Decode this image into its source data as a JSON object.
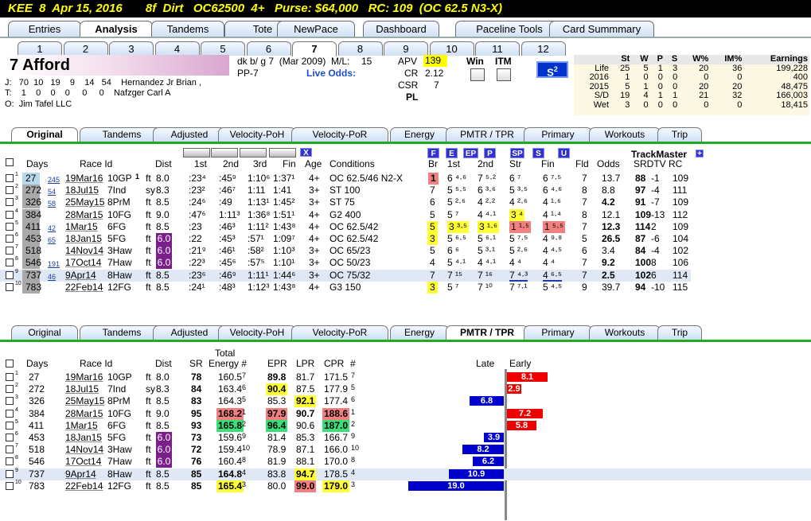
{
  "title": "KEE  8  Apr 15, 2016       8f  Dirt   OC62500  4+   Purse: $64,000   RC: 109  (OC 62.5 N3-X)",
  "menu_tabs": [
    "Entries",
    "Analysis",
    "Tandems",
    "Tote",
    "NewPace",
    "Dashboard",
    "Paceline Tools",
    "Card Summmary"
  ],
  "race_tabs": [
    "1",
    "2",
    "3",
    "4",
    "5",
    "6",
    "7",
    "8",
    "9",
    "10",
    "11",
    "12"
  ],
  "horse": {
    "name": "7   Afford",
    "desc": "dk b/ g 7  (Mar 2009)  M/L:",
    "ml": "15",
    "pp": "PP-7",
    "live_odds": "Live Odds:",
    "apv_label": "APV",
    "apv": "139",
    "cr_label": "CR",
    "cr": "2.12",
    "csr_label": "CSR",
    "csr": "7",
    "pl_label": "PL",
    "win_label": "Win",
    "itm_label": "ITM",
    "s_button": "S",
    "s_sup": "2",
    "jockey": "J:   70  10   19    9    14   54    Hernandez Jr Brian ,",
    "trainer": "T:    1    0    0    0     0     0    Nafzger Carl A",
    "owner": "O:  Jim Tafel LLC"
  },
  "stats": {
    "headers": [
      "",
      "St",
      "W",
      "P",
      "S",
      "W%",
      "IM%",
      "Earnings"
    ],
    "rows": [
      [
        "Life",
        "25",
        "5",
        "1",
        "3",
        "20",
        "36",
        "199,228"
      ],
      [
        "2016",
        "1",
        "0",
        "0",
        "0",
        "0",
        "0",
        "400"
      ],
      [
        "2015",
        "5",
        "1",
        "0",
        "0",
        "20",
        "20",
        "48,475"
      ],
      [
        "S/D",
        "19",
        "4",
        "1",
        "1",
        "21",
        "32",
        "166,003"
      ],
      [
        "Wet",
        "3",
        "0",
        "0",
        "0",
        "0",
        "0",
        "18,415"
      ]
    ]
  },
  "sub_tabs": [
    "Original",
    "Tandems",
    "Adjusted",
    "Velocity-PoH",
    "Velocity-PoR",
    "Energy",
    "PMTR / TPR",
    "Primary",
    "Workouts",
    "Trip"
  ],
  "grid1": {
    "headers": {
      "days": "Days",
      "race": "Race Id",
      "dist": "Dist",
      "c1": "1st",
      "c2": "2nd",
      "c3": "3rd",
      "fin": "Fin",
      "age": "Age",
      "cond": "Conditions",
      "br": "Br",
      "s1": "1st",
      "s2": "2nd",
      "str": "Str",
      "fin2": "Fin",
      "fld": "Fld",
      "odds": "Odds",
      "tm": "TrackMaster",
      "srdtv": "SRDTV RC",
      "x": "X",
      "plus": "+"
    },
    "letters": [
      "F",
      "E",
      "EP",
      "P",
      "SP",
      "S",
      "U"
    ],
    "rows": [
      [
        "1",
        "27",
        "245",
        "19Mar16",
        "10GP",
        "1",
        "ft",
        "8.0",
        ":23⁴",
        ":45⁹",
        "1:10⁶",
        "1:37¹",
        "4+",
        "OC 62.5/46 N2-X",
        "1",
        "6 ⁴·⁶",
        "7 ⁵·²",
        "6 ⁷",
        "6 ⁷·⁵",
        "7",
        "13.7",
        "88",
        "-1",
        "109"
      ],
      [
        "2",
        "272",
        "54",
        "18Jul15",
        "7Ind",
        "",
        "sy",
        "8.3",
        ":23²",
        ":46⁷",
        "1:11",
        "1:41",
        "3+",
        "ST 100",
        "7",
        "5 ⁵·⁵",
        "6 ³·⁶",
        "5 ³·⁵",
        "6 ⁴·⁶",
        "8",
        "8.8",
        "97",
        "-4",
        "111"
      ],
      [
        "3",
        "326",
        "58",
        "25May15",
        "8PrM",
        "",
        "ft",
        "8.5",
        ":24⁶",
        ":49",
        "1:13¹",
        "1:45²",
        "3+",
        "ST 75",
        "6",
        "5 ²·⁶",
        "4 ²·²",
        "4 ²·⁶",
        "4 ¹·⁶",
        "7",
        "4.2",
        "91",
        "-7",
        "109"
      ],
      [
        "4",
        "384",
        "",
        "28Mar15",
        "10FG",
        "",
        "ft",
        "9.0",
        ":47⁶",
        "1:11³",
        "1:36⁸",
        "1:51¹",
        "4+",
        "G2 400",
        "5",
        "5 ⁷",
        "4 ⁴·¹",
        "3 ⁴",
        "4 ¹·⁴",
        "8",
        "12.1",
        "109",
        "-13",
        "112"
      ],
      [
        "5",
        "411",
        "42",
        "1Mar15",
        "6FG",
        "",
        "ft",
        "8.5",
        ":23",
        ":46³",
        "1:11²",
        "1:43⁸",
        "4+",
        "OC 62.5/42",
        "5",
        "3 ³·⁵",
        "3 ¹·⁶",
        "1 ¹·⁵",
        "1 ⁵·⁵",
        "7",
        "12.3",
        "114",
        "2",
        "109"
      ],
      [
        "6",
        "453",
        "65",
        "18Jan15",
        "5FG",
        "",
        "ft",
        "6.0",
        ":22",
        ":45³",
        ":57¹",
        "1:09⁷",
        "4+",
        "OC 62.5/42",
        "3",
        "5 ⁶·⁵",
        "5 ⁶·¹",
        "5 ⁷·⁵",
        "4 ⁹·⁸",
        "5",
        "26.5",
        "87",
        "-6",
        "104"
      ],
      [
        "7",
        "518",
        "",
        "14Nov14",
        "3Haw",
        "",
        "ft",
        "6.0",
        ":21⁹",
        ":46¹",
        ":58²",
        "1:10³",
        "3+",
        "OC 65/23",
        "5",
        "6 ⁶",
        "5 ³·¹",
        "5 ²·⁶",
        "4 ⁴·⁵",
        "6",
        "3.4",
        "84",
        "-4",
        "102"
      ],
      [
        "8",
        "546",
        "191",
        "17Oct14",
        "7Haw",
        "",
        "ft",
        "6.0",
        ":22³",
        ":45⁶",
        ":57⁵",
        "1:10¹",
        "3+",
        "OC 50/23",
        "4",
        "5 ⁴·¹",
        "4 ⁴·¹",
        "4 ⁴",
        "4 ⁴",
        "7",
        "9.2",
        "100",
        "8",
        "106"
      ],
      [
        "9",
        "737",
        "46",
        "9Apr14",
        "8Haw",
        "",
        "ft",
        "8.5",
        ":23⁶",
        ":46⁹",
        "1:11¹",
        "1:44⁶",
        "3+",
        "OC 75/32",
        "7",
        "7 ¹⁵",
        "7 ¹⁶",
        "7 ⁴·³",
        "4 ⁶·⁵",
        "7",
        "2.5",
        "102",
        "6",
        "114"
      ],
      [
        "10",
        "783",
        "",
        "22Feb14",
        "12FG",
        "",
        "ft",
        "8.5",
        ":24¹",
        ":48³",
        "1:12³",
        "1:43⁸",
        "4+",
        "G3 150",
        "3",
        "5 ⁷",
        "7 ¹⁰",
        "7 ⁷·¹",
        "5 ⁴·⁵",
        "9",
        "39.7",
        "94",
        "-10",
        "115"
      ]
    ]
  },
  "grid2": {
    "headers": {
      "days": "Days",
      "race": "Race Id",
      "dist": "Dist",
      "sr": "SR",
      "total": "Total",
      "energy": "Energy #",
      "epr": "EPR",
      "lpr": "LPR",
      "cpr": "CPR",
      "num": "#",
      "late": "Late",
      "early": "Early"
    },
    "rows": [
      [
        "1",
        "27",
        "19Mar16",
        "10GP",
        "ft",
        "8.0",
        "78",
        "160.5",
        "7",
        "89.8",
        "81.7",
        "171.5",
        "7",
        "8.1"
      ],
      [
        "2",
        "272",
        "18Jul15",
        "7Ind",
        "sy",
        "8.3",
        "84",
        "163.4",
        "6",
        "90.4",
        "87.5",
        "177.9",
        "5",
        "2.9"
      ],
      [
        "3",
        "326",
        "25May15",
        "8PrM",
        "ft",
        "8.5",
        "83",
        "164.3",
        "5",
        "85.3",
        "92.1",
        "177.4",
        "6",
        "6.8"
      ],
      [
        "4",
        "384",
        "28Mar15",
        "10FG",
        "ft",
        "9.0",
        "95",
        "168.2",
        "1",
        "97.9",
        "90.7",
        "188.6",
        "1",
        "7.2"
      ],
      [
        "5",
        "411",
        "1Mar15",
        "6FG",
        "ft",
        "8.5",
        "93",
        "165.8",
        "2",
        "96.4",
        "90.6",
        "187.0",
        "2",
        "5.8"
      ],
      [
        "6",
        "453",
        "18Jan15",
        "5FG",
        "ft",
        "6.0",
        "73",
        "159.6",
        "9",
        "81.4",
        "85.3",
        "166.7",
        "9",
        "3.9"
      ],
      [
        "7",
        "518",
        "14Nov14",
        "3Haw",
        "ft",
        "6.0",
        "72",
        "159.4",
        "10",
        "78.9",
        "87.1",
        "166.0",
        "10",
        "8.2"
      ],
      [
        "8",
        "546",
        "17Oct14",
        "7Haw",
        "ft",
        "6.0",
        "76",
        "160.4",
        "8",
        "81.9",
        "88.1",
        "170.0",
        "8",
        "6.2"
      ],
      [
        "9",
        "737",
        "9Apr14",
        "8Haw",
        "ft",
        "8.5",
        "85",
        "164.8",
        "4",
        "83.8",
        "94.7",
        "178.5",
        "4",
        "10.9"
      ],
      [
        "10",
        "783",
        "22Feb14",
        "12FG",
        "ft",
        "8.5",
        "85",
        "165.4",
        "3",
        "80.0",
        "99.0",
        "179.0",
        "3",
        "19.0"
      ]
    ],
    "bars": [
      {
        "dir": "early",
        "value": 8.1
      },
      {
        "dir": "early",
        "value": 2.9
      },
      {
        "dir": "late",
        "value": 6.8
      },
      {
        "dir": "early",
        "value": 7.2
      },
      {
        "dir": "early",
        "value": 5.8
      },
      {
        "dir": "late",
        "value": 3.9
      },
      {
        "dir": "late",
        "value": 8.2
      },
      {
        "dir": "late",
        "value": 6.2
      },
      {
        "dir": "late",
        "value": 10.9
      },
      {
        "dir": "late",
        "value": 19.0
      }
    ]
  },
  "colors": {
    "title_bg": "#000000",
    "title_fg": "#ffff00",
    "grid_border": "#22aa22",
    "late_bar": "#0000cc",
    "early_bar": "#ee0000"
  }
}
